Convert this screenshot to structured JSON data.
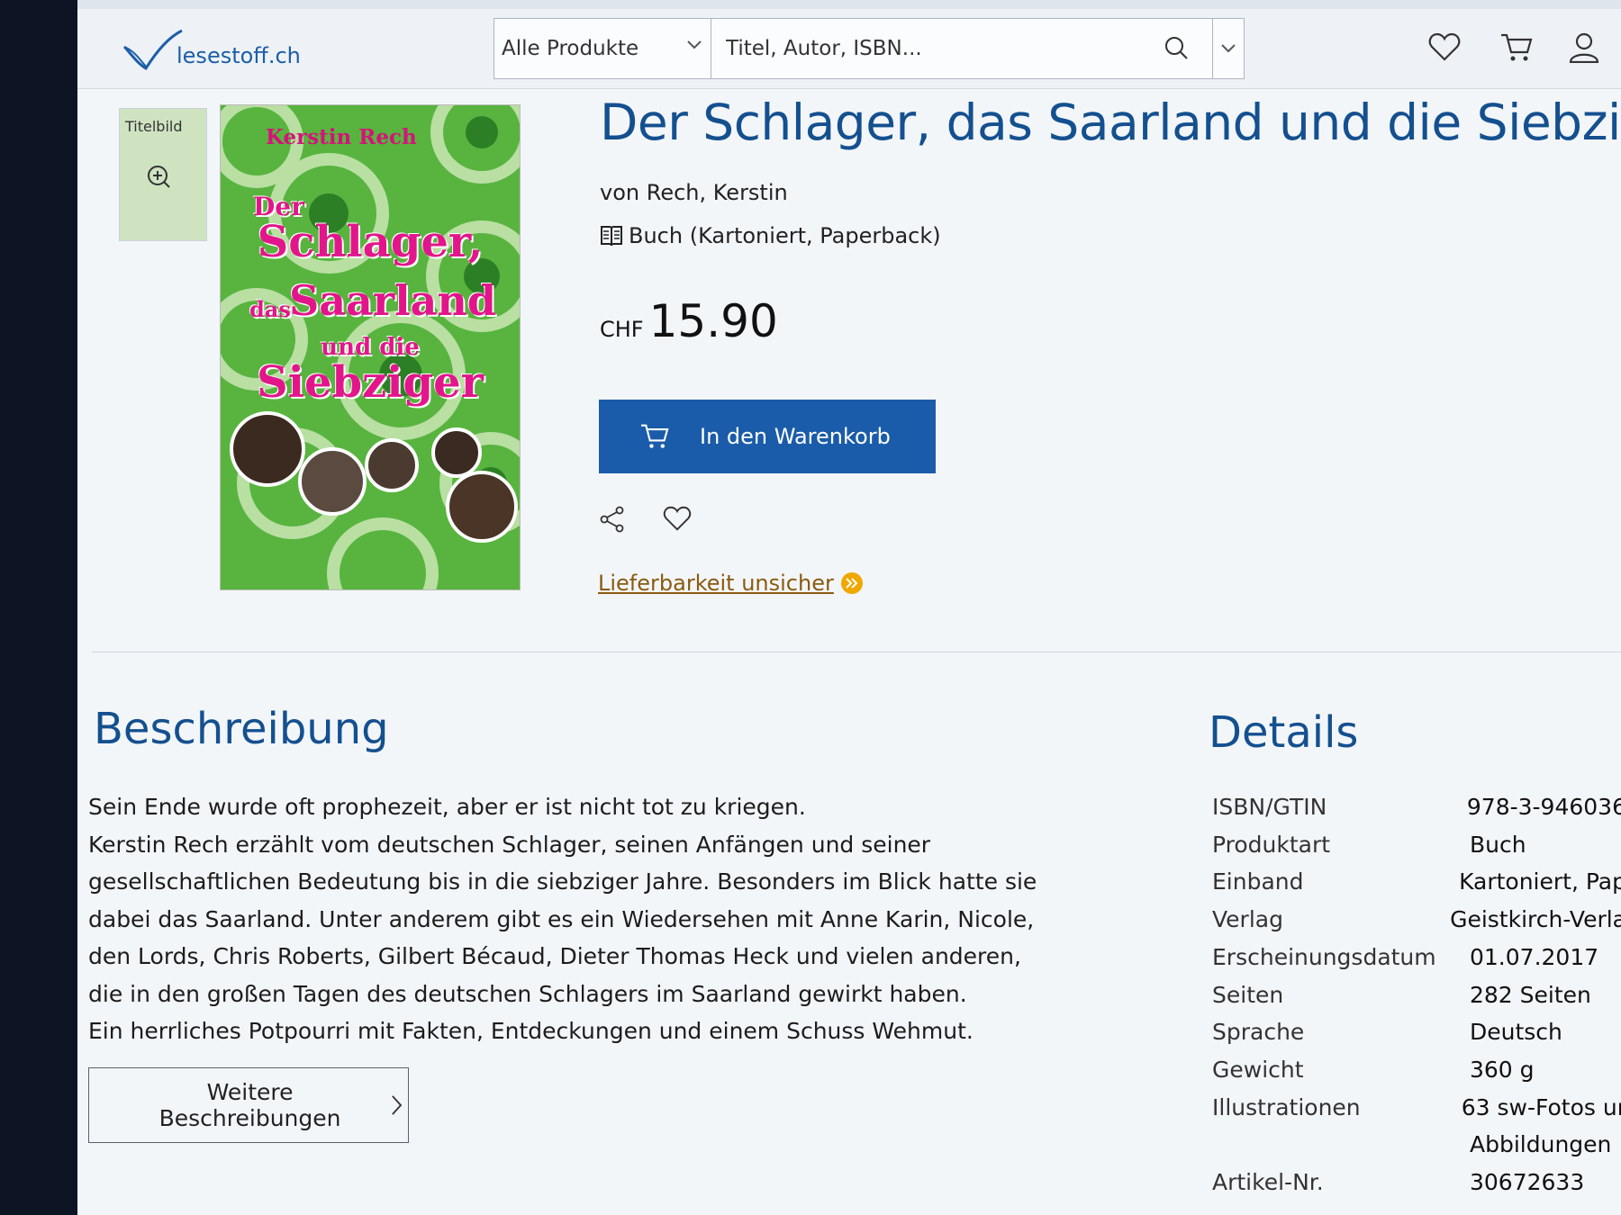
{
  "header": {
    "logo_text": "lesestoff.ch",
    "search": {
      "category": "Alle Produkte",
      "placeholder": "Titel, Autor, ISBN..."
    }
  },
  "product": {
    "thumbnail_label": "Titelbild",
    "cover": {
      "author": "Kerstin Rech",
      "line1": "Der",
      "line2": "Schlager,",
      "line3_small": "das",
      "line3": "Saarland",
      "line4": "und die",
      "line5": "Siebziger"
    },
    "title": "Der Schlager, das Saarland und die Siebziger",
    "byline": "von Rech, Kerstin",
    "format": "Buch (Kartoniert, Paperback)",
    "price_currency": "CHF",
    "price_amount": "15.90",
    "cart_button": "In den Warenkorb",
    "availability": "Lieferbarkeit unsicher"
  },
  "description": {
    "heading": "Beschreibung",
    "paragraphs": [
      "Sein Ende wurde oft prophezeit, aber er ist nicht tot zu kriegen.",
      "Kerstin Rech erzählt vom deutschen Schlager, seinen Anfängen und seiner gesellschaftlichen Bedeutung bis in die siebziger Jahre. Besonders im Blick hatte sie dabei das Saarland. Unter anderem gibt es ein Wiedersehen mit Anne Karin, Nicole, den Lords, Chris Roberts, Gilbert Bécaud, Dieter Thomas Heck und vielen anderen, die in den großen Tagen des deutschen Schlagers im Saarland gewirkt haben.",
      "Ein herrliches Potpourri mit Fakten, Entdeckungen und einem Schuss Wehmut."
    ],
    "more_button": "Weitere Beschreibungen"
  },
  "details": {
    "heading": "Details",
    "rows": [
      {
        "key": "ISBN/GTIN",
        "value": "978-3-946036"
      },
      {
        "key": "Produktart",
        "value": "Buch"
      },
      {
        "key": "Einband",
        "value": "Kartoniert, Pap"
      },
      {
        "key": "Verlag",
        "value": "Geistkirch-Verla"
      },
      {
        "key": "Erscheinungsdatum",
        "value": "01.07.2017"
      },
      {
        "key": "Seiten",
        "value": "282 Seiten"
      },
      {
        "key": "Sprache",
        "value": "Deutsch"
      },
      {
        "key": "Gewicht",
        "value": "360 g"
      },
      {
        "key": "Illustrationen",
        "value": "63 sw-Fotos ur"
      },
      {
        "key": "",
        "value": "Abbildungen"
      },
      {
        "key": "Artikel-Nr.",
        "value": "30672633"
      }
    ]
  },
  "icons": {
    "search": "search-icon",
    "wishlist": "heart-icon",
    "cart": "cart-icon",
    "account": "user-icon",
    "share": "share-icon",
    "format": "book-icon"
  },
  "colors": {
    "brand_blue": "#14508f",
    "button_blue": "#1a5ca9",
    "availability": "#f0a700"
  }
}
